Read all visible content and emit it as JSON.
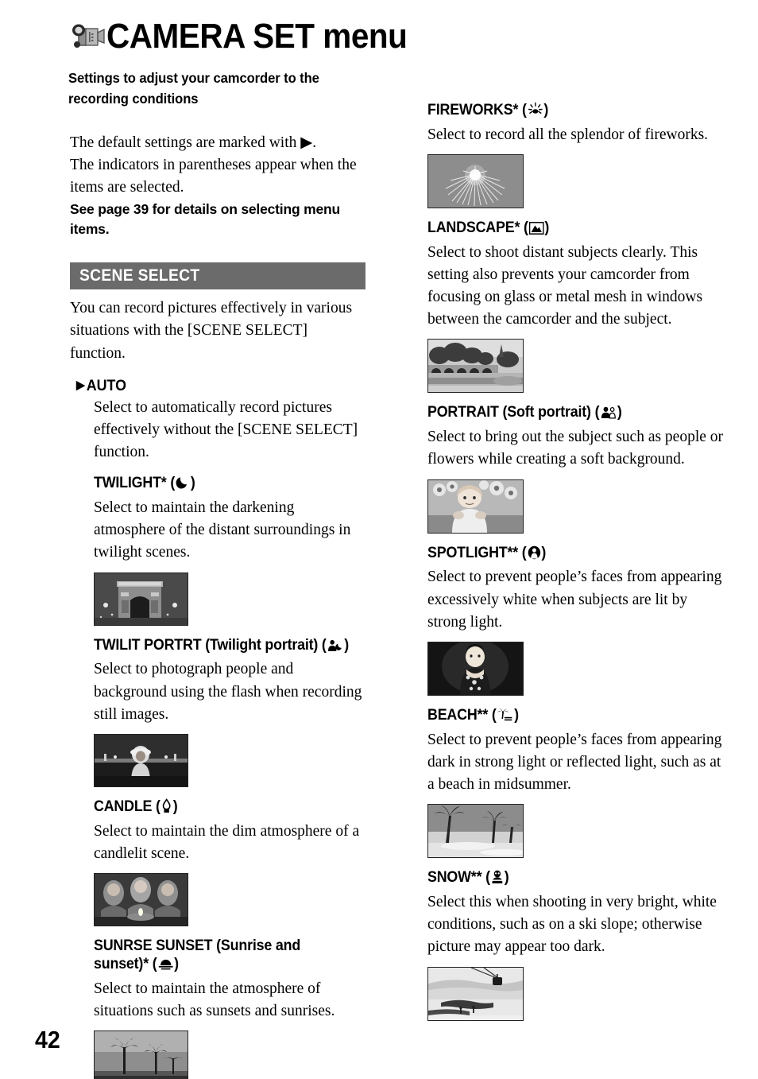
{
  "header": {
    "title": "CAMERA SET menu",
    "camcorder_icon": "camcorder-icon",
    "subtitle": "Settings to adjust your camcorder to the recording conditions"
  },
  "intro": {
    "line1": "The default settings are marked with ▶.",
    "line2": "The indicators in parentheses appear when the items are selected.",
    "bold_note": "See page 39 for details on selecting menu items."
  },
  "section": {
    "bar_label": "SCENE SELECT",
    "description": "You can record pictures effectively in various situations with the [SCENE SELECT] function."
  },
  "left_column": {
    "entries": [
      {
        "id": "auto",
        "marker": "▶",
        "title": "AUTO",
        "icon": "none",
        "body": "Select to automatically record pictures effectively without the [SCENE SELECT] function.",
        "photo": null
      },
      {
        "id": "twilight",
        "title_pre": "TWILIGHT* (",
        "title_post": ")",
        "icon": "crescent-moon-icon",
        "body": "Select to maintain the darkening atmosphere of the distant surroundings in twilight scenes.",
        "photo": "arc-de-triomphe-night-photo"
      },
      {
        "id": "twilit-portrt",
        "title_pre": "TWILIT PORTRT (Twilight portrait) (",
        "title_post": ")",
        "icon": "person-moon-icon",
        "body": "Select to photograph people and background using the flash when recording still images.",
        "photo": "twilight-portrait-photo"
      },
      {
        "id": "candle",
        "title_pre": "CANDLE (",
        "title_post": ")",
        "icon": "candle-icon",
        "body": "Select to maintain the dim atmosphere of a candlelit scene.",
        "photo": "candlelit-group-photo"
      },
      {
        "id": "sunrse-sunset",
        "title_pre": "SUNRSE SUNSET (Sunrise and sunset)* (",
        "title_post": ")",
        "icon": "sunset-icon",
        "body": "Select to maintain the atmosphere of situations such as sunsets and sunrises.",
        "photo": "palm-sunset-photo"
      }
    ]
  },
  "right_column": {
    "entries": [
      {
        "id": "fireworks",
        "title_pre": "FIREWORKS* (",
        "title_post": ")",
        "icon": "fireworks-icon",
        "body": "Select to record all the splendor of fireworks.",
        "photo": "fireworks-photo"
      },
      {
        "id": "landscape",
        "title_pre": "LANDSCAPE* (",
        "title_post": ")",
        "icon": "landscape-mountain-icon",
        "body": "Select to shoot distant subjects clearly. This setting also prevents your camcorder from focusing on glass or metal mesh in windows between the camcorder and the subject.",
        "photo": "bridge-landscape-photo"
      },
      {
        "id": "portrait",
        "title_pre": "PORTRAIT (Soft portrait) (",
        "title_post": ")",
        "icon": "two-people-icon",
        "body": "Select to bring out the subject such as people or flowers while creating a soft background.",
        "photo": "child-portrait-photo"
      },
      {
        "id": "spotlight",
        "title_pre": "SPOTLIGHT** (",
        "title_post": ")",
        "icon": "spotlight-person-icon",
        "body": "Select to prevent people’s faces from appearing excessively white when subjects are lit by strong light.",
        "photo": "spotlight-woman-photo"
      },
      {
        "id": "beach",
        "title_pre": "BEACH** (",
        "title_post": ")",
        "icon": "palm-tree-waves-icon",
        "body": "Select to prevent people’s faces from appearing dark in strong light or reflected light, such as at a beach in midsummer.",
        "photo": "beach-palms-photo"
      },
      {
        "id": "snow",
        "title_pre": "SNOW** (",
        "title_post": ")",
        "icon": "snowman-icon",
        "body": "Select this when shooting in very bright, white conditions, such as on a ski slope; otherwise picture may appear too dark.",
        "photo": "ski-slope-photo"
      }
    ]
  },
  "footer": {
    "page_number": "42"
  },
  "colors": {
    "section_bar_bg": "#6b6b6b",
    "section_bar_text": "#ffffff",
    "text": "#000000",
    "page_bg": "#ffffff"
  }
}
